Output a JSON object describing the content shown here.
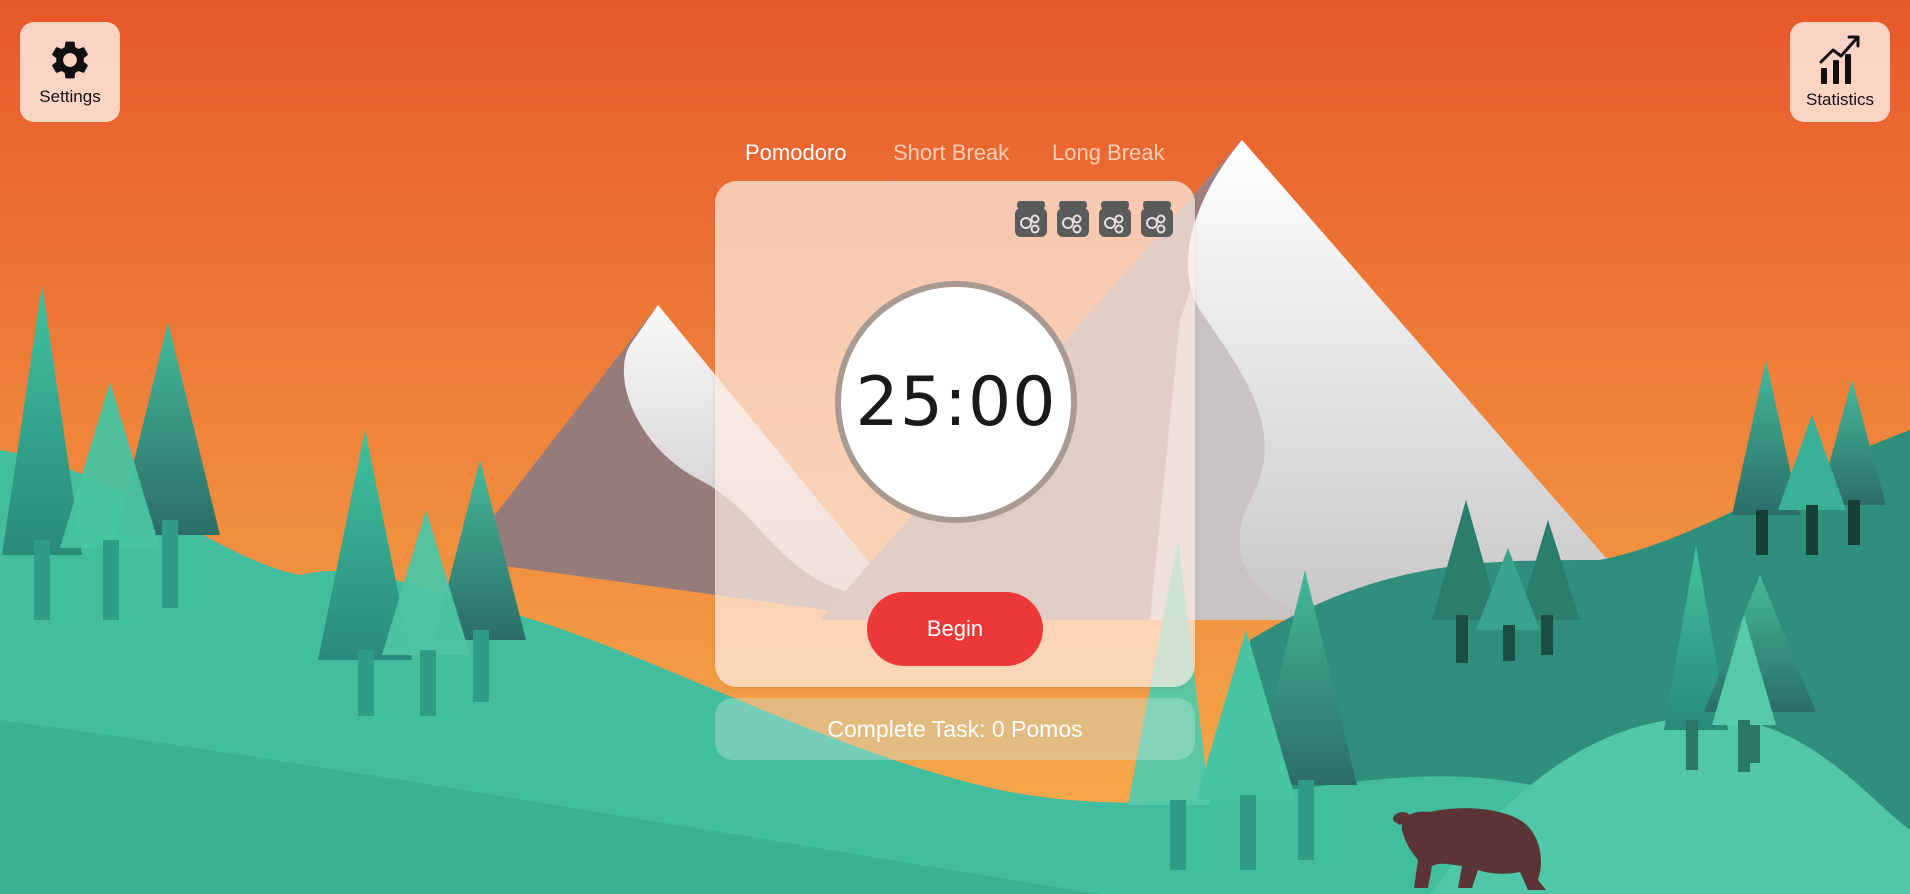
{
  "header": {
    "settings_label": "Settings",
    "statistics_label": "Statistics"
  },
  "tabs": [
    {
      "label": "Pomodoro",
      "active": true
    },
    {
      "label": "Short Break",
      "active": false
    },
    {
      "label": "Long Break",
      "active": false
    }
  ],
  "timer": {
    "display": "25:00",
    "pomodoro_jars_count": 4,
    "jar_icon": "honey-jar-icon"
  },
  "begin_button": {
    "label": "Begin"
  },
  "task": {
    "label": "Complete Task: 0 Pomos"
  },
  "colors": {
    "accent": "#ee3737",
    "sky_top": "#e85a2c",
    "sky_bottom": "#f5a24a",
    "hill": "#3dbd9f"
  },
  "icons": {
    "settings": "gear-icon",
    "statistics": "chart-trend-icon"
  }
}
